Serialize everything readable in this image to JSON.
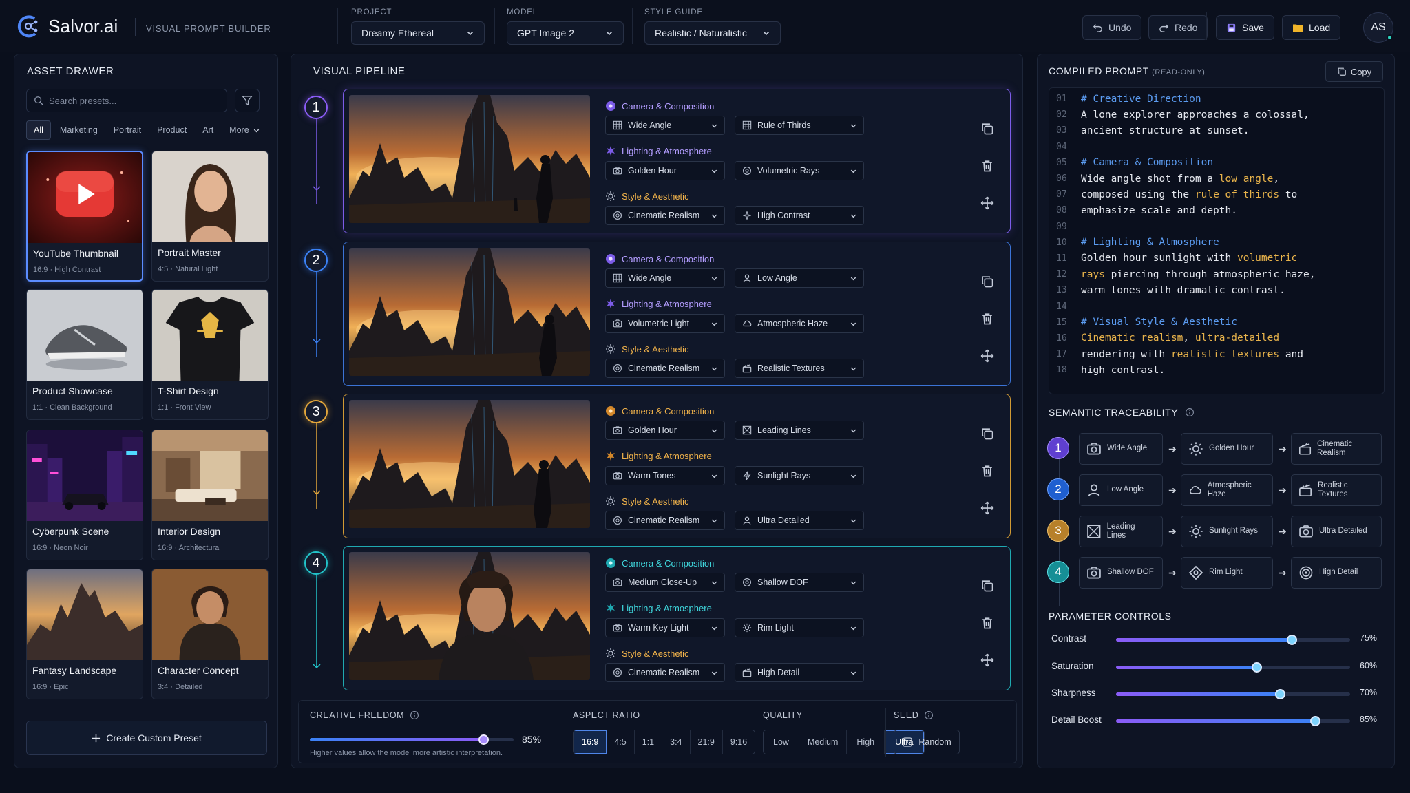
{
  "app": {
    "name": "Salvor.ai",
    "subtitle": "VISUAL PROMPT BUILDER"
  },
  "topbar": {
    "project": {
      "label": "PROJECT",
      "value": "Dreamy Ethereal"
    },
    "model": {
      "label": "MODEL",
      "value": "GPT Image 2"
    },
    "style": {
      "label": "STYLE GUIDE",
      "value": "Realistic / Naturalistic"
    },
    "undo": "Undo",
    "redo": "Redo",
    "save": "Save",
    "load": "Load",
    "avatar": "AS"
  },
  "drawer": {
    "title": "ASSET DRAWER",
    "search_placeholder": "Search presets...",
    "chips": [
      "All",
      "Marketing",
      "Portrait",
      "Product",
      "Art",
      "More"
    ],
    "cards": [
      {
        "title": "YouTube Thumbnail",
        "sub": "16:9  ·  High Contrast"
      },
      {
        "title": "Portrait Master",
        "sub": "4:5  ·  Natural Light"
      },
      {
        "title": "Product Showcase",
        "sub": "1:1  ·  Clean Background"
      },
      {
        "title": "T-Shirt Design",
        "sub": "1:1  ·  Front View"
      },
      {
        "title": "Cyberpunk Scene",
        "sub": "16:9  ·  Neon Noir"
      },
      {
        "title": "Interior Design",
        "sub": "16:9  ·  Architectural"
      },
      {
        "title": "Fantasy Landscape",
        "sub": "16:9  ·  Epic"
      },
      {
        "title": "Character Concept",
        "sub": "3:4  ·  Detailed"
      }
    ],
    "create": "Create Custom Preset"
  },
  "pipeline": {
    "title": "VISUAL PIPELINE",
    "groups": [
      "Camera & Composition",
      "Lighting & Atmosphere",
      "Style & Aesthetic"
    ],
    "steps": [
      {
        "num": "1",
        "color": "#8b5cf6",
        "camera": [
          "Wide Angle",
          "Rule of Thirds"
        ],
        "lighting": [
          "Golden Hour",
          "Volumetric Rays"
        ],
        "style": [
          "Cinematic Realism",
          "High Contrast"
        ]
      },
      {
        "num": "2",
        "color": "#3b82f6",
        "camera": [
          "Wide Angle",
          "Low Angle"
        ],
        "lighting": [
          "Volumetric Light",
          "Atmospheric Haze"
        ],
        "style": [
          "Cinematic Realism",
          "Realistic Textures"
        ]
      },
      {
        "num": "3",
        "color": "#e2a63b",
        "camera": [
          "Golden Hour",
          "Leading Lines"
        ],
        "lighting": [
          "Warm Tones",
          "Sunlight Rays"
        ],
        "style": [
          "Cinematic Realism",
          "Ultra Detailed"
        ]
      },
      {
        "num": "4",
        "color": "#22c3c9",
        "camera": [
          "Medium Close-Up",
          "Shallow DOF"
        ],
        "lighting": [
          "Warm Key Light",
          "Rim Light"
        ],
        "style": [
          "Cinematic Realism",
          "High Detail"
        ]
      }
    ],
    "creative": {
      "label": "CREATIVE FREEDOM",
      "value": 85,
      "display": "85%",
      "hint": "Higher values allow the model more artistic interpretation."
    },
    "aspect": {
      "label": "ASPECT RATIO",
      "options": [
        "16:9",
        "4:5",
        "1:1",
        "3:4",
        "21:9",
        "9:16"
      ],
      "selected": "16:9"
    },
    "quality": {
      "label": "QUALITY",
      "options": [
        "Low",
        "Medium",
        "High",
        "Ultra"
      ],
      "selected": "Ultra"
    },
    "seed": {
      "label": "SEED",
      "value": "Random"
    }
  },
  "prompt": {
    "title": "COMPILED PROMPT",
    "readonly": "(READ-ONLY)",
    "copy": "Copy",
    "lines": [
      {
        "n": "01",
        "parts": [
          [
            "cm",
            "# Creative Direction"
          ]
        ]
      },
      {
        "n": "02",
        "parts": [
          [
            "tx",
            "A lone explorer approaches a colossal,"
          ]
        ]
      },
      {
        "n": "03",
        "parts": [
          [
            "tx",
            "ancient structure at sunset."
          ]
        ]
      },
      {
        "n": "04",
        "parts": []
      },
      {
        "n": "05",
        "parts": [
          [
            "cm",
            "# Camera & Composition"
          ]
        ]
      },
      {
        "n": "06",
        "parts": [
          [
            "tx",
            "Wide angle shot from a "
          ],
          [
            "hl",
            "low angle"
          ],
          [
            "tx",
            ","
          ]
        ]
      },
      {
        "n": "07",
        "parts": [
          [
            "tx",
            "composed using the "
          ],
          [
            "hl",
            "rule of thirds"
          ],
          [
            "tx",
            " to"
          ]
        ]
      },
      {
        "n": "08",
        "parts": [
          [
            "tx",
            "emphasize scale and depth."
          ]
        ]
      },
      {
        "n": "09",
        "parts": []
      },
      {
        "n": "10",
        "parts": [
          [
            "cm",
            "# Lighting & Atmosphere"
          ]
        ]
      },
      {
        "n": "11",
        "parts": [
          [
            "tx",
            "Golden hour sunlight with "
          ],
          [
            "hl",
            "volumetric"
          ]
        ]
      },
      {
        "n": "12",
        "parts": [
          [
            "hl",
            "rays"
          ],
          [
            "tx",
            " piercing through atmospheric haze,"
          ]
        ]
      },
      {
        "n": "13",
        "parts": [
          [
            "tx",
            "warm tones with dramatic contrast."
          ]
        ]
      },
      {
        "n": "14",
        "parts": []
      },
      {
        "n": "15",
        "parts": [
          [
            "cm",
            "# Visual Style & Aesthetic"
          ]
        ]
      },
      {
        "n": "16",
        "parts": [
          [
            "hl",
            "Cinematic realism"
          ],
          [
            "tx",
            ", "
          ],
          [
            "hl",
            "ultra-detailed"
          ]
        ]
      },
      {
        "n": "17",
        "parts": [
          [
            "tx",
            "rendering with "
          ],
          [
            "hl",
            "realistic textures"
          ],
          [
            "tx",
            " and"
          ]
        ]
      },
      {
        "n": "18",
        "parts": [
          [
            "tx",
            "high contrast."
          ]
        ]
      }
    ]
  },
  "trace": {
    "title": "SEMANTIC TRACEABILITY",
    "rows": [
      {
        "num": "1",
        "color": "#8b5cf6",
        "items": [
          "Wide Angle",
          "Golden Hour",
          "Cinematic Realism"
        ]
      },
      {
        "num": "2",
        "color": "#3b82f6",
        "items": [
          "Low Angle",
          "Atmospheric Haze",
          "Realistic Textures"
        ]
      },
      {
        "num": "3",
        "color": "#e2a63b",
        "items": [
          "Leading Lines",
          "Sunlight Rays",
          "Ultra Detailed"
        ]
      },
      {
        "num": "4",
        "color": "#22c3c9",
        "items": [
          "Shallow DOF",
          "Rim Light",
          "High Detail"
        ]
      }
    ]
  },
  "params": {
    "title": "PARAMETER CONTROLS",
    "sliders": [
      {
        "label": "Contrast",
        "value": 75,
        "display": "75%"
      },
      {
        "label": "Saturation",
        "value": 60,
        "display": "60%"
      },
      {
        "label": "Sharpness",
        "value": 70,
        "display": "70%"
      },
      {
        "label": "Detail Boost",
        "value": 85,
        "display": "85%"
      }
    ]
  },
  "colors": {
    "accent": "#3b82f6",
    "step1": "#8b5cf6",
    "step2": "#3b82f6",
    "step3": "#e2a63b",
    "step4": "#22c3c9",
    "highlight": "#e8b34b"
  }
}
